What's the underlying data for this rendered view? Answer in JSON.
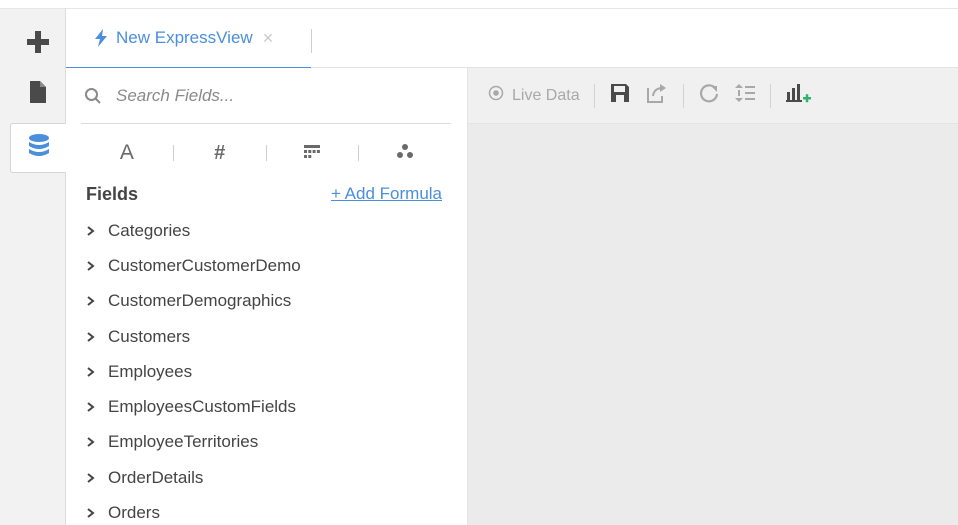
{
  "rail": {
    "items": [
      {
        "icon": "plus-icon"
      },
      {
        "icon": "document-icon"
      },
      {
        "icon": "database-icon",
        "active": true
      }
    ]
  },
  "tab": {
    "label": "New ExpressView",
    "icon": "lightning-icon",
    "close_icon": "close-icon",
    "accent": "#4a8fdc"
  },
  "search": {
    "placeholder": "Search Fields...",
    "value": ""
  },
  "type_filters": [
    {
      "icon": "text-type-icon",
      "glyph": "A"
    },
    {
      "icon": "numeric-type-icon",
      "glyph": "#"
    },
    {
      "icon": "date-type-icon"
    },
    {
      "icon": "geo-type-icon"
    }
  ],
  "fields": {
    "title": "Fields",
    "add_formula_label": "+ Add Formula",
    "items": [
      {
        "label": "Categories"
      },
      {
        "label": "CustomerCustomerDemo"
      },
      {
        "label": "CustomerDemographics"
      },
      {
        "label": "Customers"
      },
      {
        "label": "Employees"
      },
      {
        "label": "EmployeesCustomFields"
      },
      {
        "label": "EmployeeTerritories"
      },
      {
        "label": "OrderDetails"
      },
      {
        "label": "Orders"
      }
    ]
  },
  "toolbar": {
    "live_data_label": "Live Data",
    "items": [
      "save-icon",
      "share-icon",
      "refresh-icon",
      "sort-icon",
      "add-chart-icon"
    ]
  },
  "colors": {
    "accent": "#4a8fdc",
    "canvas_bg": "#ebebeb",
    "add_chart_plus": "#2fb36b"
  }
}
